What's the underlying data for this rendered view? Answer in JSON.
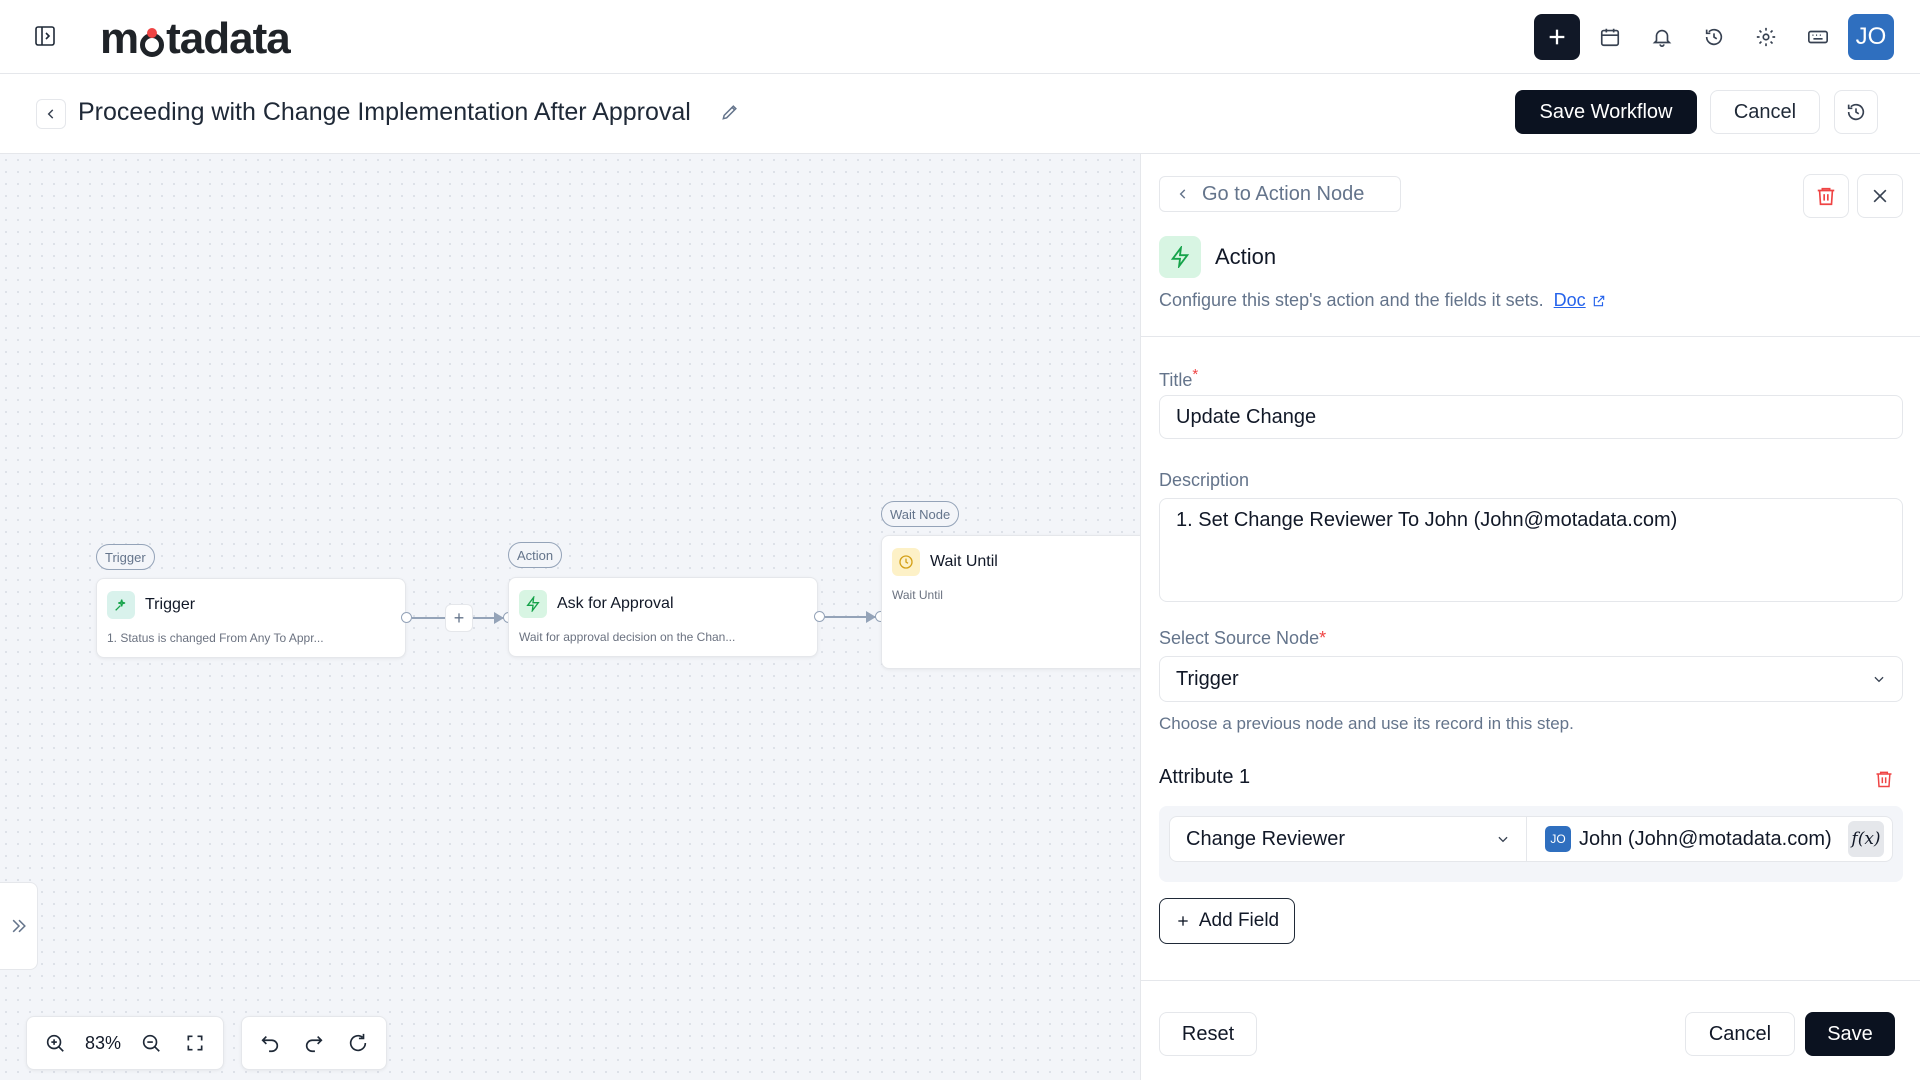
{
  "brand": {
    "logo_text_a": "m",
    "logo_dot": "●",
    "logo_text_b": "tadata"
  },
  "topbar": {
    "icons": [
      "sidebar-toggle-icon",
      "plus-icon",
      "calendar-icon",
      "bell-icon",
      "history-icon",
      "gear-icon",
      "keyboard-icon"
    ],
    "avatar_initials": "JO"
  },
  "header": {
    "title": "Proceeding with Change Implementation After Approval",
    "save_label": "Save Workflow",
    "cancel_label": "Cancel"
  },
  "canvas": {
    "nodes": [
      {
        "tag": "Trigger",
        "title": "Trigger",
        "desc": "1. Status is changed From Any To Appr...",
        "icon": "trigger-icon",
        "color": "#d9f2ec"
      },
      {
        "tag": "Action",
        "title": "Ask for Approval",
        "desc": "Wait for approval decision on the Chan...",
        "icon": "bolt-icon",
        "color": "#d8f5e3"
      },
      {
        "tag": "Wait Node",
        "title": "Wait Until",
        "desc": "Wait Until",
        "icon": "clock-icon",
        "color": "#fdf1c7"
      }
    ],
    "between_add": "+",
    "zoom_level": "83%"
  },
  "panel": {
    "goto_label": "Go to Action Node",
    "heading": "Action",
    "subtitle": "Configure this step's action and the fields it sets.",
    "doc_label": "Doc",
    "title_label": "Title",
    "required_mark": "*",
    "title_value": "Update Change",
    "description_label": "Description",
    "description_value": "1. Set Change Reviewer To John (John@motadata.com)",
    "source_label": "Select Source Node",
    "source_value": "Trigger",
    "source_helper": "Choose a previous node and use its record in this step.",
    "attribute_title": "Attribute 1",
    "attribute_field": "Change Reviewer",
    "attribute_avatar": "JO",
    "attribute_value": "John (John@motadata.com)",
    "fx_label": "f(x)",
    "add_field_label": "Add Field",
    "reset_label": "Reset",
    "cancel_label": "Cancel",
    "save_label": "Save"
  },
  "colors": {
    "primary": "#0b1220",
    "accent_blue": "#2f6fbf",
    "danger": "#ef4444",
    "link": "#2563eb"
  }
}
